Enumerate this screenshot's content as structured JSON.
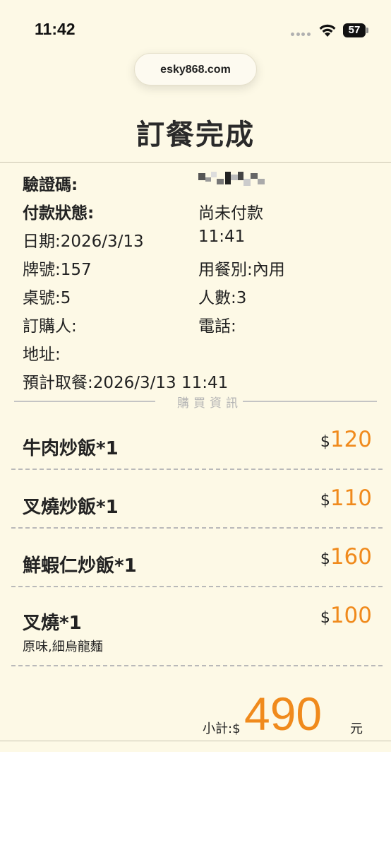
{
  "status_bar": {
    "time": "11:42",
    "battery": "57"
  },
  "browser": {
    "url": "esky868.com"
  },
  "page": {
    "title": "訂餐完成"
  },
  "info": {
    "verification_label": "驗證碼:",
    "payment_label": "付款狀態:",
    "payment_value": "尚未付款",
    "date": "日期:2026/3/13",
    "time": "11:41",
    "plate": "牌號:157",
    "dining_type": "用餐別:內用",
    "table": "桌號:5",
    "people": "人數:3",
    "orderer": "訂購人:",
    "phone": "電話:",
    "address": "地址:",
    "pickup": "預計取餐:2026/3/13 11:41"
  },
  "section": {
    "purchase_info": "購買資訊"
  },
  "items": [
    {
      "name": "牛肉炒飯*1",
      "currency": "$",
      "price": "120",
      "note": ""
    },
    {
      "name": "叉燒炒飯*1",
      "currency": "$",
      "price": "110",
      "note": ""
    },
    {
      "name": "鮮蝦仁炒飯*1",
      "currency": "$",
      "price": "160",
      "note": ""
    },
    {
      "name": "叉燒*1",
      "currency": "$",
      "price": "100",
      "note": "原味,細烏龍麵"
    }
  ],
  "subtotal": {
    "label": "小計:$",
    "amount": "490",
    "unit": "元"
  },
  "colors": {
    "accent": "#f08a1c",
    "background": "#fdf9e6"
  },
  "icons": [
    "signal-icon",
    "wifi-icon",
    "battery-icon"
  ]
}
